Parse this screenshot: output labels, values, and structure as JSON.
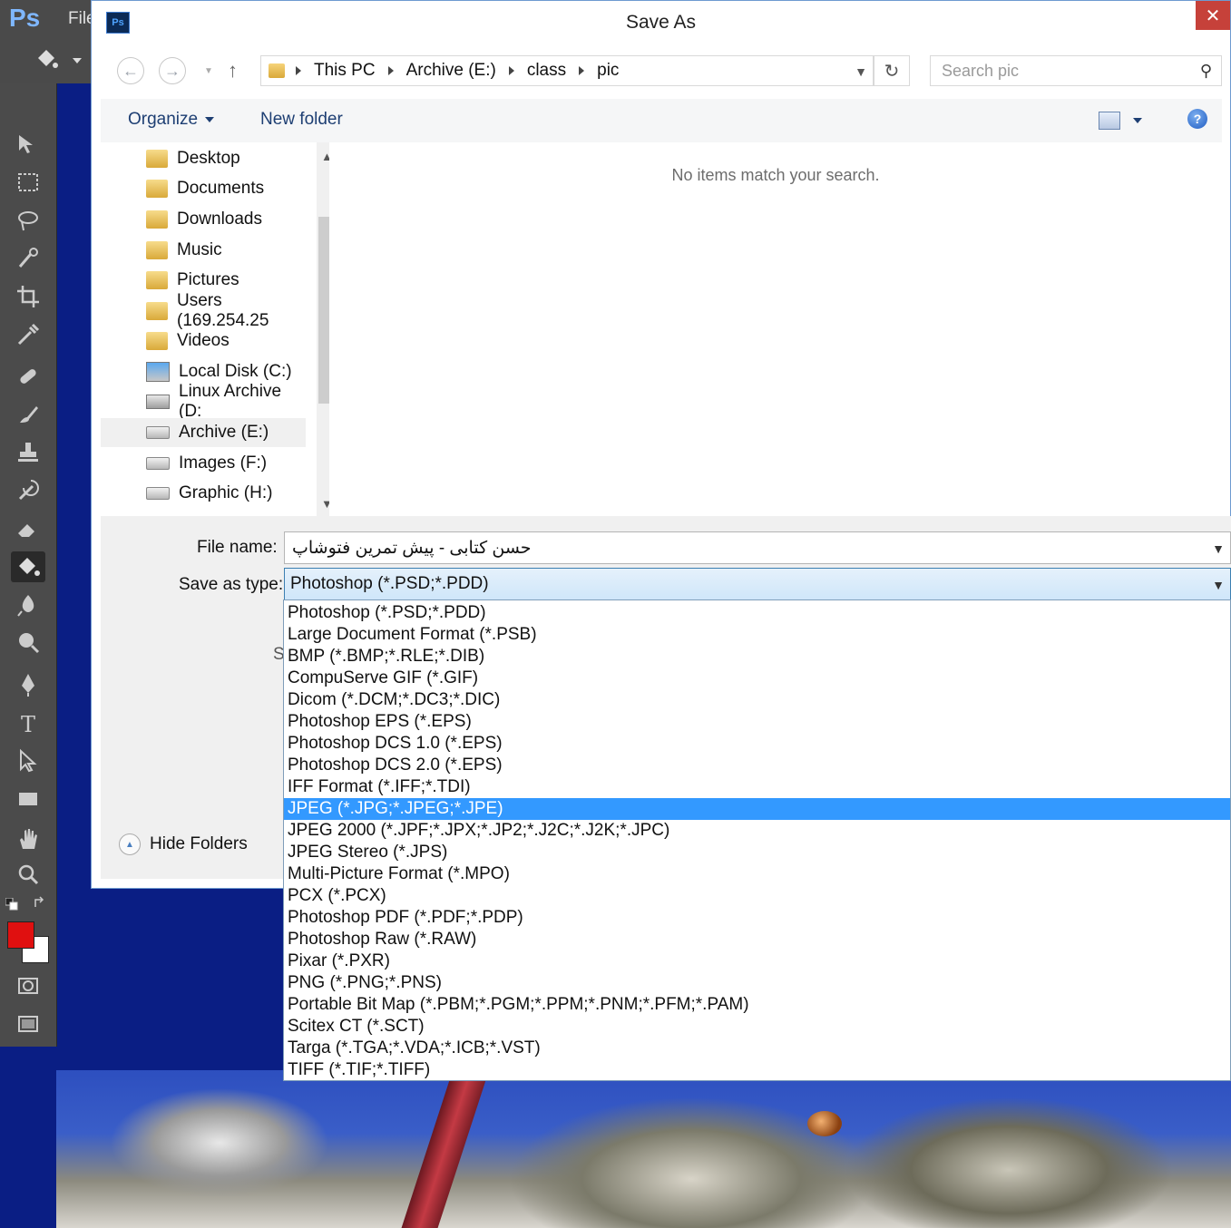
{
  "photoshop": {
    "logo": "Ps",
    "file_menu": "File"
  },
  "dialog": {
    "title": "Save As",
    "app_icon": "Ps",
    "close_glyph": "✕"
  },
  "breadcrumbs": [
    "This PC",
    "Archive (E:)",
    "class",
    "pic"
  ],
  "search": {
    "placeholder": "Search pic"
  },
  "toolbar": {
    "organize_label": "Organize",
    "new_folder_label": "New folder",
    "help_glyph": "?"
  },
  "nav_pane": {
    "items": [
      {
        "label": "Desktop",
        "icon": "desktop-folder-icon"
      },
      {
        "label": "Documents",
        "icon": "documents-folder-icon"
      },
      {
        "label": "Downloads",
        "icon": "downloads-folder-icon"
      },
      {
        "label": "Music",
        "icon": "music-folder-icon"
      },
      {
        "label": "Pictures",
        "icon": "pictures-folder-icon"
      },
      {
        "label": "Users (169.254.25",
        "icon": "network-folder-icon"
      },
      {
        "label": "Videos",
        "icon": "videos-folder-icon"
      },
      {
        "label": "Local Disk (C:)",
        "icon": "local-disk-icon"
      },
      {
        "label": "Linux Archive (D:",
        "icon": "network-drive-icon"
      },
      {
        "label": "Archive (E:)",
        "icon": "drive-icon"
      },
      {
        "label": "Images (F:)",
        "icon": "drive-icon"
      },
      {
        "label": "Graphic (H:)",
        "icon": "drive-icon"
      }
    ],
    "selected_index": 9
  },
  "files_pane": {
    "empty_message": "No items match your search."
  },
  "form": {
    "file_name_label": "File name:",
    "file_name_value": "حسن کتابی - پیش تمرین فتوشاپ",
    "save_type_label": "Save as type:",
    "save_type_value": "Photoshop (*.PSD;*.PDD)",
    "hidden_label_fragment": "S"
  },
  "hide_folders_label": "Hide Folders",
  "save_type_options": [
    "Photoshop (*.PSD;*.PDD)",
    "Large Document Format (*.PSB)",
    "BMP (*.BMP;*.RLE;*.DIB)",
    "CompuServe GIF (*.GIF)",
    "Dicom (*.DCM;*.DC3;*.DIC)",
    "Photoshop EPS (*.EPS)",
    "Photoshop DCS 1.0 (*.EPS)",
    "Photoshop DCS 2.0 (*.EPS)",
    "IFF Format (*.IFF;*.TDI)",
    "JPEG (*.JPG;*.JPEG;*.JPE)",
    "JPEG 2000 (*.JPF;*.JPX;*.JP2;*.J2C;*.J2K;*.JPC)",
    "JPEG Stereo (*.JPS)",
    "Multi-Picture Format (*.MPO)",
    "PCX (*.PCX)",
    "Photoshop PDF (*.PDF;*.PDP)",
    "Photoshop Raw (*.RAW)",
    "Pixar (*.PXR)",
    "PNG (*.PNG;*.PNS)",
    "Portable Bit Map (*.PBM;*.PGM;*.PPM;*.PNM;*.PFM;*.PAM)",
    "Scitex CT (*.SCT)",
    "Targa (*.TGA;*.VDA;*.ICB;*.VST)",
    "TIFF (*.TIF;*.TIFF)"
  ],
  "highlighted_option_index": 9,
  "colors": {
    "foreground": "#e01010",
    "background": "#ffffff",
    "highlight": "#3399ff",
    "close_button": "#c6413a"
  }
}
